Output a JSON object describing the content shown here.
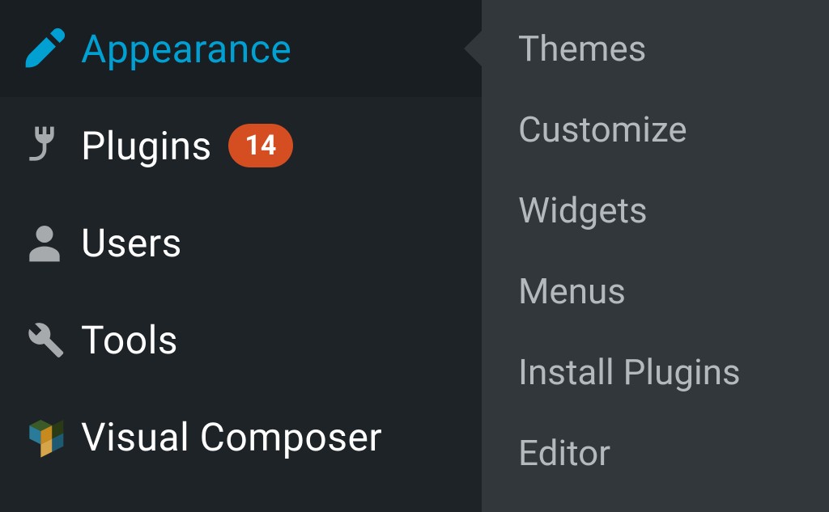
{
  "colors": {
    "accent": "#00a0d2",
    "badge": "#d54e21",
    "sidebarBg": "#1e2327",
    "submenuBg": "#32373c",
    "iconDefault": "#a7aaad",
    "submenuText": "#b4b9be"
  },
  "sidebar": {
    "items": [
      {
        "icon": "brush-icon",
        "label": "Appearance",
        "active": true
      },
      {
        "icon": "plug-icon",
        "label": "Plugins",
        "badge": "14"
      },
      {
        "icon": "user-icon",
        "label": "Users"
      },
      {
        "icon": "wrench-icon",
        "label": "Tools"
      },
      {
        "icon": "cube-icon",
        "label": "Visual Composer"
      }
    ]
  },
  "submenu": {
    "items": [
      {
        "label": "Themes"
      },
      {
        "label": "Customize"
      },
      {
        "label": "Widgets"
      },
      {
        "label": "Menus"
      },
      {
        "label": "Install Plugins"
      },
      {
        "label": "Editor"
      }
    ]
  }
}
